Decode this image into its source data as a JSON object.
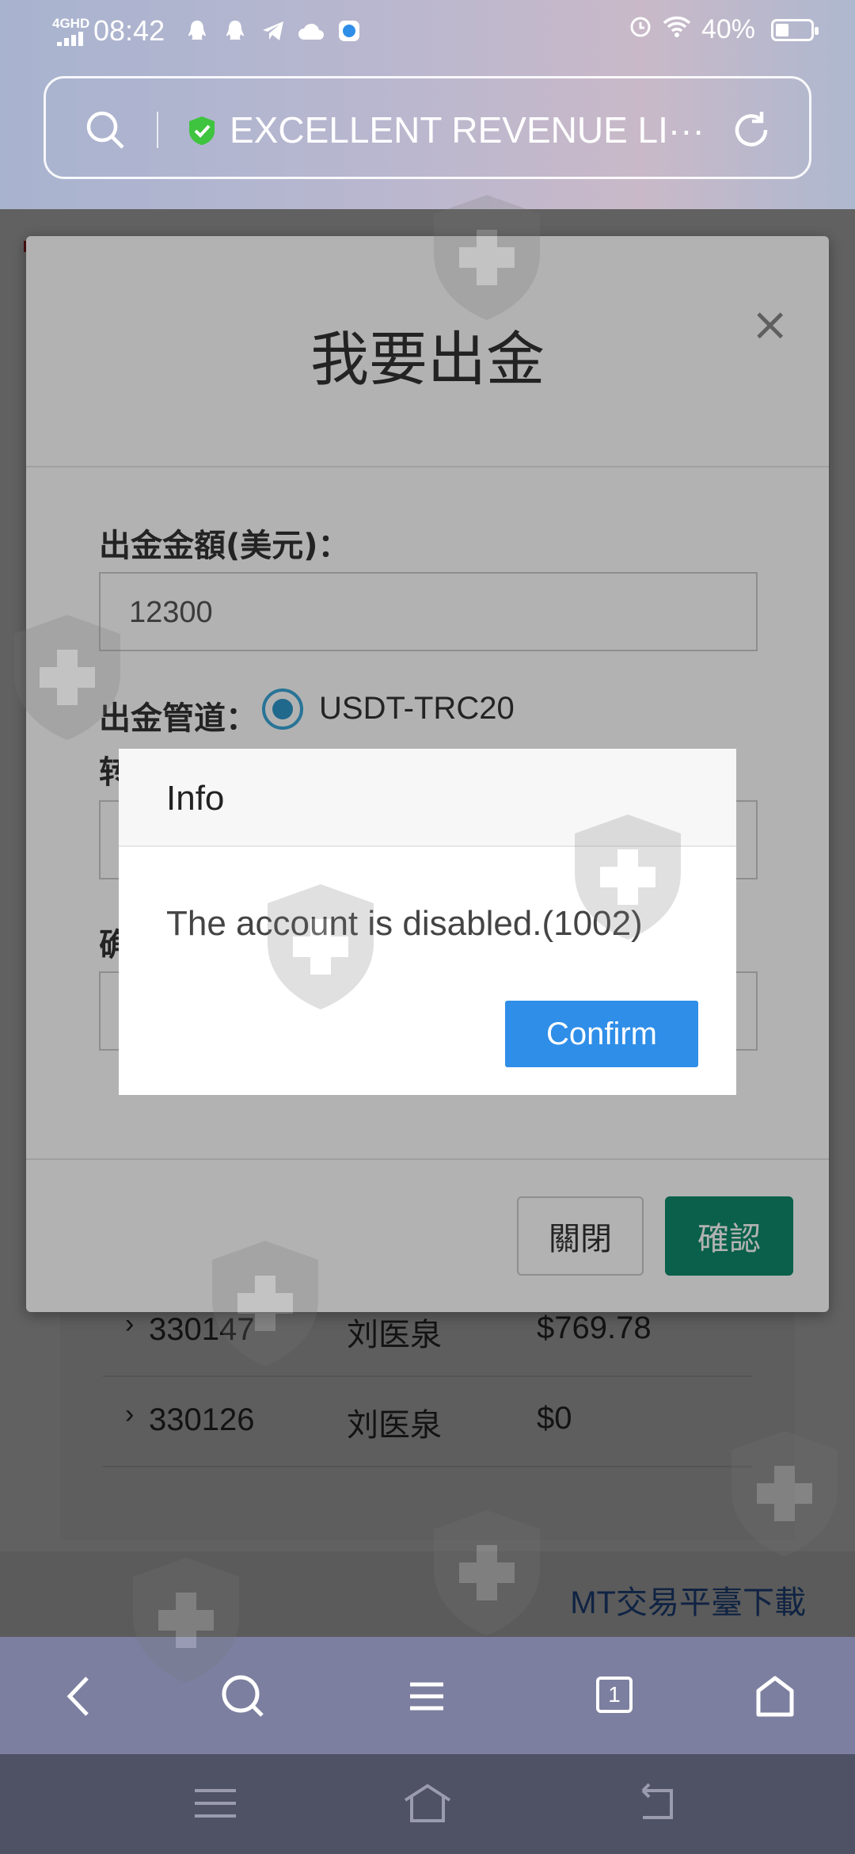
{
  "status_bar": {
    "network": "4GHD",
    "time": "08:42",
    "battery": "40%"
  },
  "url_bar": {
    "title": "EXCELLENT REVENUE LI···"
  },
  "background_page": {
    "rows": [
      {
        "id": "330147",
        "name": "刘医泉",
        "amount": "$769.78"
      },
      {
        "id": "330126",
        "name": "刘医泉",
        "amount": "$0"
      }
    ],
    "footer_link": "MT交易平臺下載"
  },
  "withdraw_modal": {
    "title": "我要出金",
    "close_symbol": "×",
    "amount_label": "出金金額(美元)：",
    "amount_value": "12300",
    "channel_label": "出金管道：",
    "channel_option": "USDT-TRC20",
    "field3_label_partial": "转",
    "field4_label_partial": "确",
    "cancel_label": "關閉",
    "confirm_label": "確認"
  },
  "info_dialog": {
    "title": "Info",
    "message": "The account is disabled.(1002)",
    "confirm_label": "Confirm"
  },
  "browser_toolbar": {
    "tab_count": "1"
  },
  "colors": {
    "confirm_blue": "#2f8ee8",
    "confirm_green": "#0f8a6a",
    "radio_blue": "#2f97c9",
    "toolbar": "#7c7f9f"
  }
}
